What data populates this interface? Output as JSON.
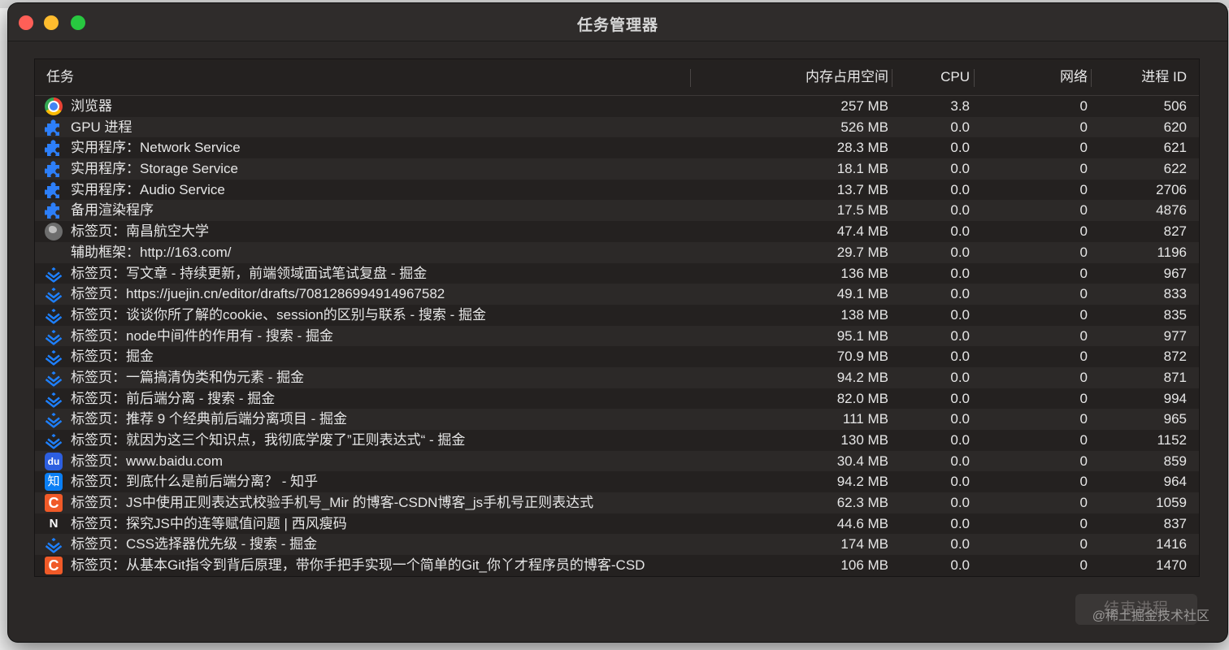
{
  "window": {
    "title": "任务管理器"
  },
  "table": {
    "headers": {
      "task": "任务",
      "memory": "内存占用空间",
      "cpu": "CPU",
      "network": "网络",
      "pid": "进程 ID"
    },
    "rows": [
      {
        "icon": "chrome-icon",
        "name": "浏览器",
        "memory": "257 MB",
        "cpu": "3.8",
        "network": "0",
        "pid": "506"
      },
      {
        "icon": "puzzle-icon",
        "name": "GPU 进程",
        "memory": "526 MB",
        "cpu": "0.0",
        "network": "0",
        "pid": "620"
      },
      {
        "icon": "puzzle-icon",
        "name": "实用程序：Network Service",
        "memory": "28.3 MB",
        "cpu": "0.0",
        "network": "0",
        "pid": "621"
      },
      {
        "icon": "puzzle-icon",
        "name": "实用程序：Storage Service",
        "memory": "18.1 MB",
        "cpu": "0.0",
        "network": "0",
        "pid": "622"
      },
      {
        "icon": "puzzle-icon",
        "name": "实用程序：Audio Service",
        "memory": "13.7 MB",
        "cpu": "0.0",
        "network": "0",
        "pid": "2706"
      },
      {
        "icon": "puzzle-icon",
        "name": "备用渲染程序",
        "memory": "17.5 MB",
        "cpu": "0.0",
        "network": "0",
        "pid": "4876"
      },
      {
        "icon": "globe-icon",
        "name": "标签页：南昌航空大学",
        "memory": "47.4 MB",
        "cpu": "0.0",
        "network": "0",
        "pid": "827"
      },
      {
        "icon": "",
        "name": "辅助框架：http://163.com/",
        "memory": "29.7 MB",
        "cpu": "0.0",
        "network": "0",
        "pid": "1196"
      },
      {
        "icon": "juejin-icon",
        "name": "标签页：写文章 - 持续更新，前端领域面试笔试复盘 - 掘金",
        "memory": "136 MB",
        "cpu": "0.0",
        "network": "0",
        "pid": "967"
      },
      {
        "icon": "juejin-icon",
        "name": "标签页：https://juejin.cn/editor/drafts/7081286994914967582",
        "memory": "49.1 MB",
        "cpu": "0.0",
        "network": "0",
        "pid": "833"
      },
      {
        "icon": "juejin-icon",
        "name": "标签页：谈谈你所了解的cookie、session的区别与联系 - 搜索 - 掘金",
        "memory": "138 MB",
        "cpu": "0.0",
        "network": "0",
        "pid": "835"
      },
      {
        "icon": "juejin-icon",
        "name": "标签页：node中间件的作用有 - 搜索 - 掘金",
        "memory": "95.1 MB",
        "cpu": "0.0",
        "network": "0",
        "pid": "977"
      },
      {
        "icon": "juejin-icon",
        "name": "标签页：掘金",
        "memory": "70.9 MB",
        "cpu": "0.0",
        "network": "0",
        "pid": "872"
      },
      {
        "icon": "juejin-icon",
        "name": "标签页：一篇搞清伪类和伪元素 - 掘金",
        "memory": "94.2 MB",
        "cpu": "0.0",
        "network": "0",
        "pid": "871"
      },
      {
        "icon": "juejin-icon",
        "name": "标签页：前后端分离 - 搜索 - 掘金",
        "memory": "82.0 MB",
        "cpu": "0.0",
        "network": "0",
        "pid": "994"
      },
      {
        "icon": "juejin-icon",
        "name": "标签页：推荐 9 个经典前后端分离项目 - 掘金",
        "memory": "111 MB",
        "cpu": "0.0",
        "network": "0",
        "pid": "965"
      },
      {
        "icon": "juejin-icon",
        "name": "标签页：就因为这三个知识点，我彻底学废了”正则表达式“ - 掘金",
        "memory": "130 MB",
        "cpu": "0.0",
        "network": "0",
        "pid": "1152"
      },
      {
        "icon": "baidu-icon",
        "name": "标签页：www.baidu.com",
        "memory": "30.4 MB",
        "cpu": "0.0",
        "network": "0",
        "pid": "859"
      },
      {
        "icon": "zhihu-icon",
        "name": "标签页：到底什么是前后端分离？ - 知乎",
        "memory": "94.2 MB",
        "cpu": "0.0",
        "network": "0",
        "pid": "964"
      },
      {
        "icon": "csdn-icon",
        "name": "标签页：JS中使用正则表达式校验手机号_Mir 的博客-CSDN博客_js手机号正则表达式",
        "memory": "62.3 MB",
        "cpu": "0.0",
        "network": "0",
        "pid": "1059"
      },
      {
        "icon": "n-icon",
        "name": "标签页：探究JS中的连等赋值问题 | 西风瘦码",
        "memory": "44.6 MB",
        "cpu": "0.0",
        "network": "0",
        "pid": "837"
      },
      {
        "icon": "juejin-icon",
        "name": "标签页：CSS选择器优先级 - 搜索 - 掘金",
        "memory": "174 MB",
        "cpu": "0.0",
        "network": "0",
        "pid": "1416"
      },
      {
        "icon": "csdn-icon",
        "name": "标签页：从基本Git指令到背后原理，带你手把手实现一个简单的Git_你丫才程序员的博客-CSD",
        "memory": "106 MB",
        "cpu": "0.0",
        "network": "0",
        "pid": "1470"
      }
    ]
  },
  "actions": {
    "end_process": "结束进程"
  },
  "watermark": "@稀土掘金技术社区"
}
